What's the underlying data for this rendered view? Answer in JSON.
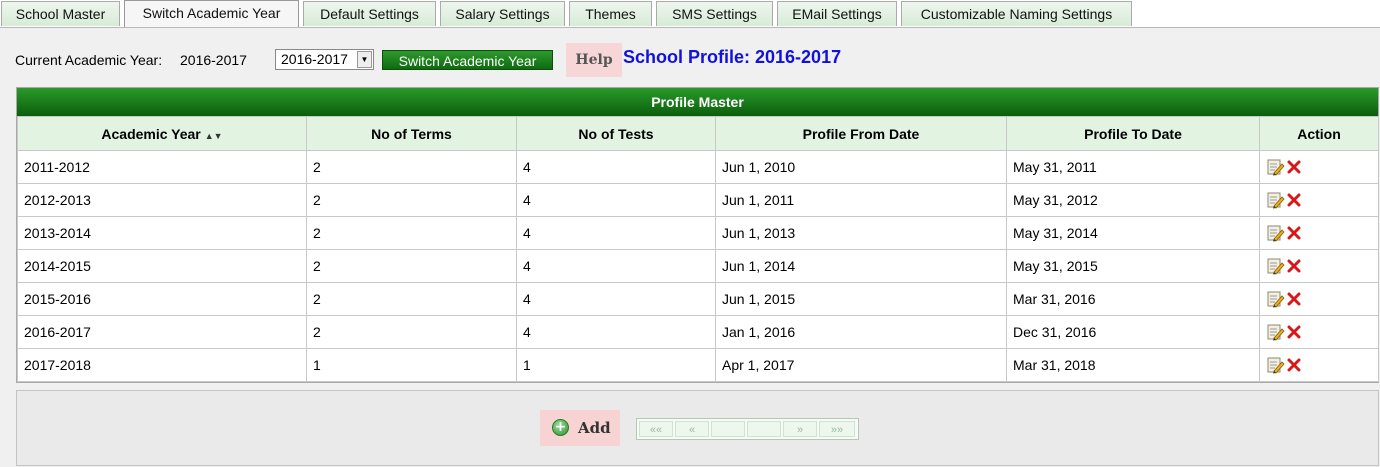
{
  "tabs": [
    {
      "label": "School Master",
      "active": false
    },
    {
      "label": "Switch Academic Year",
      "active": true
    },
    {
      "label": "Default Settings",
      "active": false
    },
    {
      "label": "Salary Settings",
      "active": false
    },
    {
      "label": "Themes",
      "active": false
    },
    {
      "label": "SMS Settings",
      "active": false
    },
    {
      "label": "EMail Settings",
      "active": false
    },
    {
      "label": "Customizable Naming Settings",
      "active": false
    }
  ],
  "toolbar": {
    "current_label": "Current Academic Year:",
    "current_value": "2016-2017",
    "select_value": "2016-2017",
    "switch_label": "Switch Academic Year",
    "help_label": "Help",
    "profile_title": "School Profile: 2016-2017"
  },
  "grid": {
    "caption": "Profile Master",
    "columns": [
      "Academic Year",
      "No of Terms",
      "No of Tests",
      "Profile From Date",
      "Profile To Date",
      "Action"
    ],
    "rows": [
      [
        "2011-2012",
        "2",
        "4",
        "Jun 1, 2010",
        "May 31, 2011"
      ],
      [
        "2012-2013",
        "2",
        "4",
        "Jun 1, 2011",
        "May 31, 2012"
      ],
      [
        "2013-2014",
        "2",
        "4",
        "Jun 1, 2013",
        "May 31, 2014"
      ],
      [
        "2014-2015",
        "2",
        "4",
        "Jun 1, 2014",
        "May 31, 2015"
      ],
      [
        "2015-2016",
        "2",
        "4",
        "Jun 1, 2015",
        "Mar 31, 2016"
      ],
      [
        "2016-2017",
        "2",
        "4",
        "Jan 1, 2016",
        "Dec 31, 2016"
      ],
      [
        "2017-2018",
        "1",
        "1",
        "Apr 1, 2017",
        "Mar 31, 2018"
      ]
    ],
    "action_icons": [
      "edit-icon",
      "delete-icon"
    ]
  },
  "footer": {
    "add_label": "Add",
    "pager": {
      "first": "««",
      "prev": "«",
      "next": "»",
      "last": "»»"
    }
  },
  "colors": {
    "header_green": "#1a7f1a",
    "column_header_bg": "#e2f3e2",
    "title_blue": "#1111dd",
    "help_bg": "#f6d6d6",
    "delete_red": "#d81818"
  }
}
